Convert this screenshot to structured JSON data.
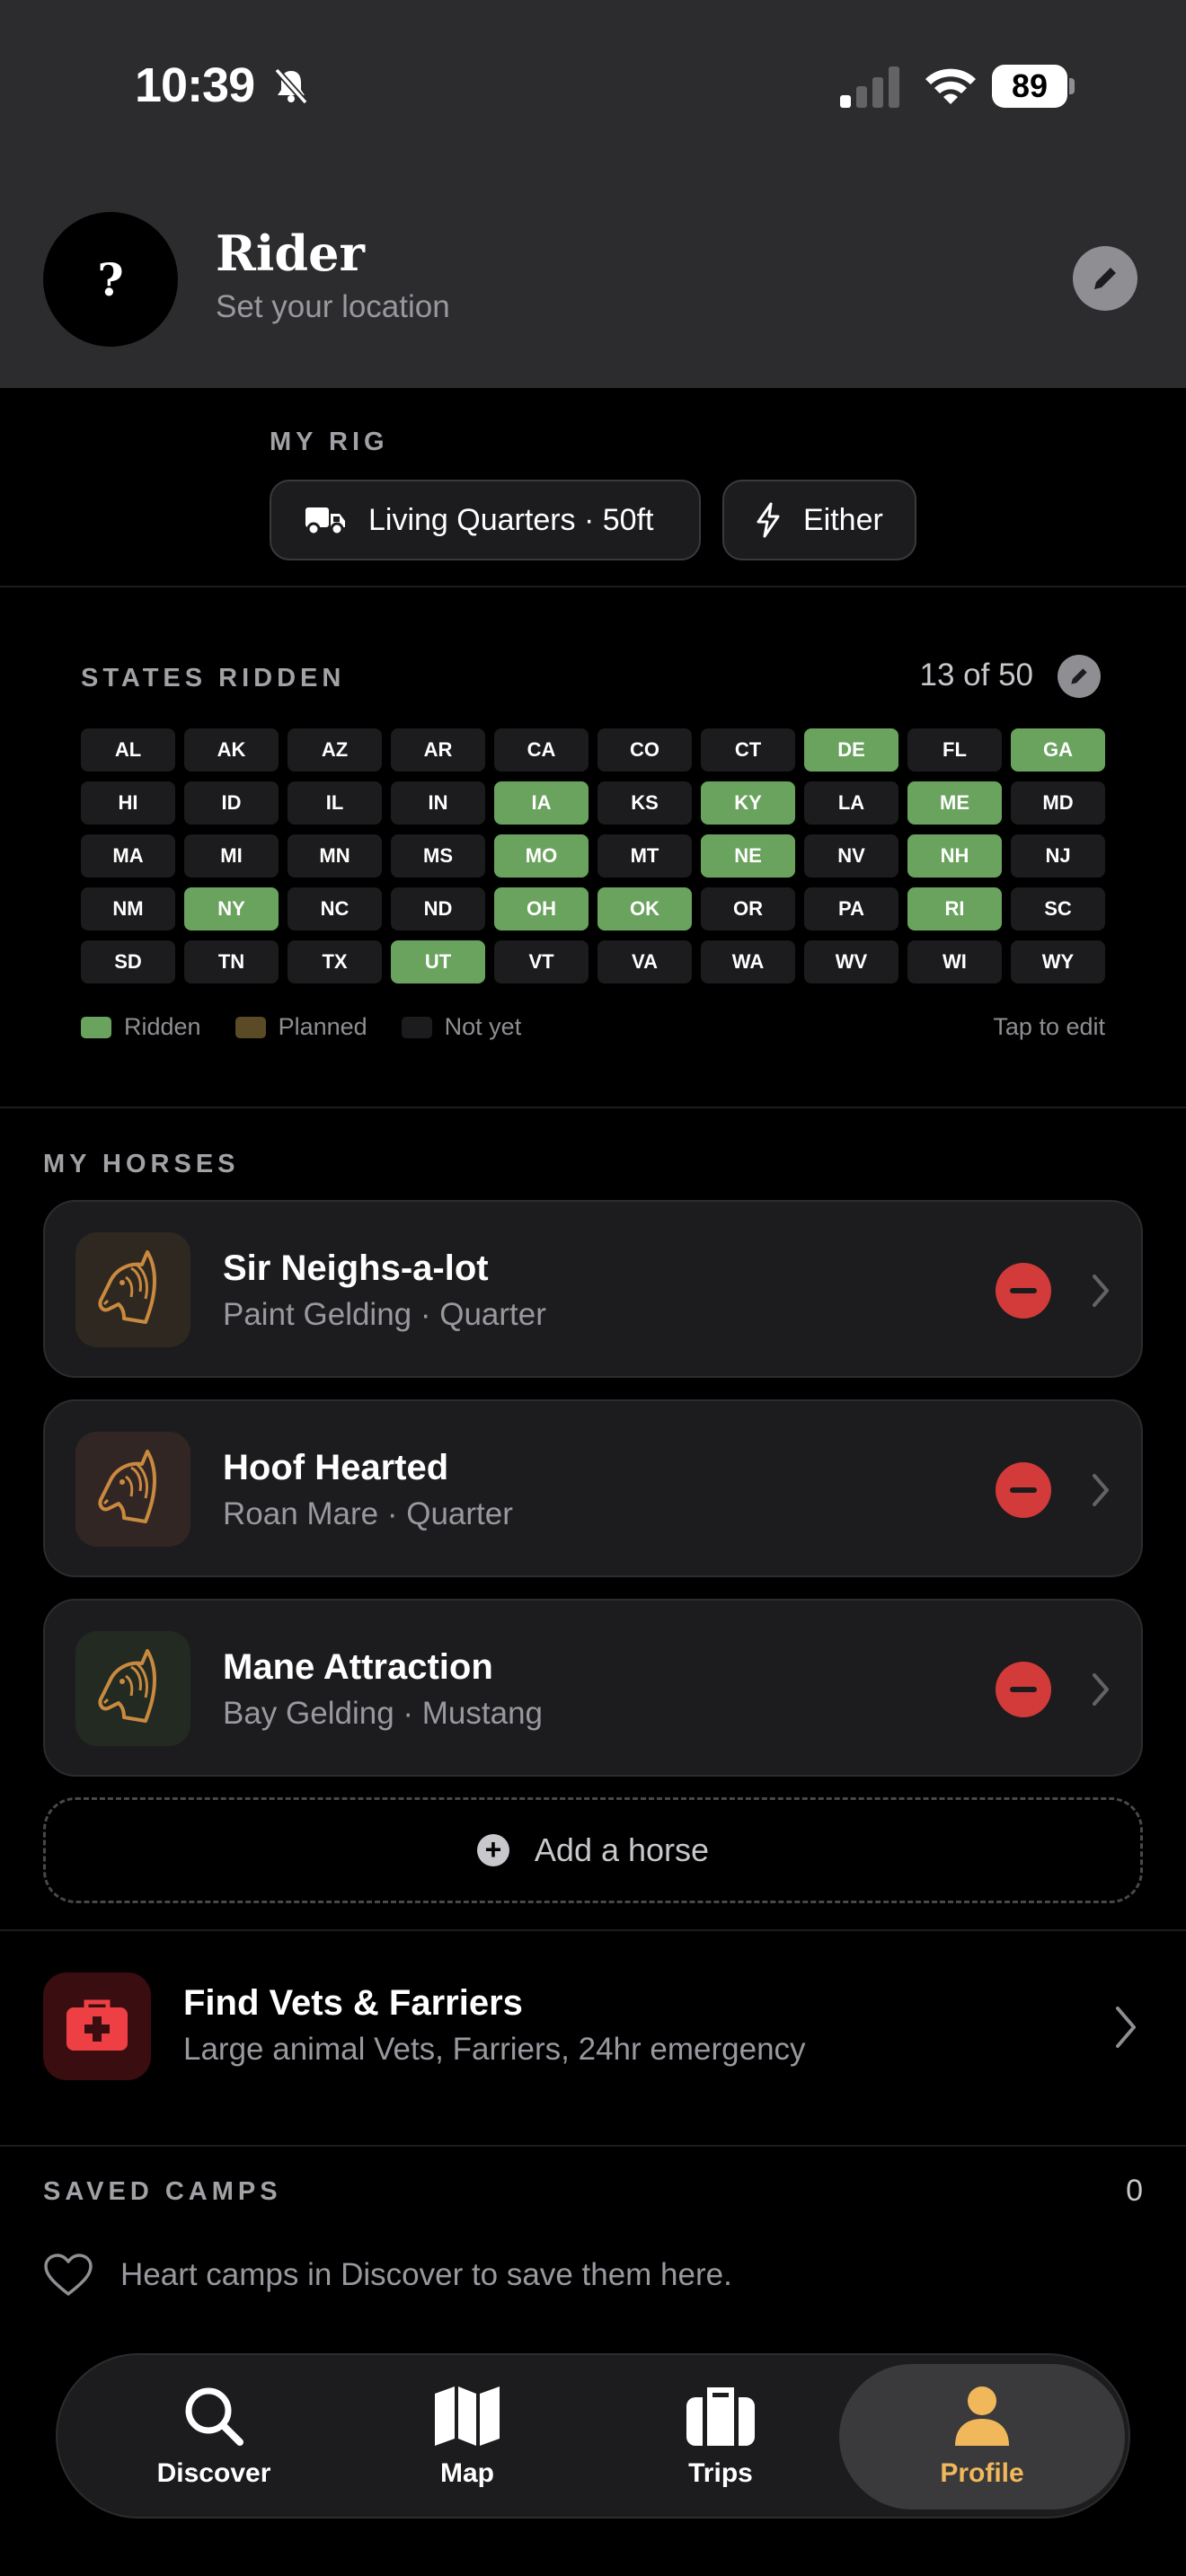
{
  "status_bar": {
    "time": "10:39",
    "battery": "89"
  },
  "profile": {
    "avatar_glyph": "?",
    "name": "Rider",
    "location": "Set your location"
  },
  "rig": {
    "title": "MY RIG",
    "vehicle_label": "Living Quarters · 50ft",
    "hookup_label": "Either"
  },
  "states": {
    "title": "STATES RIDDEN",
    "count": "13 of 50",
    "tap_to_edit": "Tap to edit",
    "legend": {
      "ridden": "Ridden",
      "planned": "Planned",
      "not_yet": "Not yet"
    },
    "colors": {
      "ridden": "#6aa35e",
      "planned": "#5a4a25",
      "not_yet": "#1c1c1e"
    },
    "list": [
      {
        "code": "AL",
        "status": "not_yet"
      },
      {
        "code": "AK",
        "status": "not_yet"
      },
      {
        "code": "AZ",
        "status": "not_yet"
      },
      {
        "code": "AR",
        "status": "not_yet"
      },
      {
        "code": "CA",
        "status": "not_yet"
      },
      {
        "code": "CO",
        "status": "not_yet"
      },
      {
        "code": "CT",
        "status": "not_yet"
      },
      {
        "code": "DE",
        "status": "ridden"
      },
      {
        "code": "FL",
        "status": "not_yet"
      },
      {
        "code": "GA",
        "status": "ridden"
      },
      {
        "code": "HI",
        "status": "not_yet"
      },
      {
        "code": "ID",
        "status": "not_yet"
      },
      {
        "code": "IL",
        "status": "not_yet"
      },
      {
        "code": "IN",
        "status": "not_yet"
      },
      {
        "code": "IA",
        "status": "ridden"
      },
      {
        "code": "KS",
        "status": "not_yet"
      },
      {
        "code": "KY",
        "status": "ridden"
      },
      {
        "code": "LA",
        "status": "not_yet"
      },
      {
        "code": "ME",
        "status": "ridden"
      },
      {
        "code": "MD",
        "status": "not_yet"
      },
      {
        "code": "MA",
        "status": "not_yet"
      },
      {
        "code": "MI",
        "status": "not_yet"
      },
      {
        "code": "MN",
        "status": "not_yet"
      },
      {
        "code": "MS",
        "status": "not_yet"
      },
      {
        "code": "MO",
        "status": "ridden"
      },
      {
        "code": "MT",
        "status": "not_yet"
      },
      {
        "code": "NE",
        "status": "ridden"
      },
      {
        "code": "NV",
        "status": "not_yet"
      },
      {
        "code": "NH",
        "status": "ridden"
      },
      {
        "code": "NJ",
        "status": "not_yet"
      },
      {
        "code": "NM",
        "status": "not_yet"
      },
      {
        "code": "NY",
        "status": "ridden"
      },
      {
        "code": "NC",
        "status": "not_yet"
      },
      {
        "code": "ND",
        "status": "not_yet"
      },
      {
        "code": "OH",
        "status": "ridden"
      },
      {
        "code": "OK",
        "status": "ridden"
      },
      {
        "code": "OR",
        "status": "not_yet"
      },
      {
        "code": "PA",
        "status": "not_yet"
      },
      {
        "code": "RI",
        "status": "ridden"
      },
      {
        "code": "SC",
        "status": "not_yet"
      },
      {
        "code": "SD",
        "status": "not_yet"
      },
      {
        "code": "TN",
        "status": "not_yet"
      },
      {
        "code": "TX",
        "status": "not_yet"
      },
      {
        "code": "UT",
        "status": "ridden"
      },
      {
        "code": "VT",
        "status": "not_yet"
      },
      {
        "code": "VA",
        "status": "not_yet"
      },
      {
        "code": "WA",
        "status": "not_yet"
      },
      {
        "code": "WV",
        "status": "not_yet"
      },
      {
        "code": "WI",
        "status": "not_yet"
      },
      {
        "code": "WY",
        "status": "not_yet"
      }
    ]
  },
  "horses": {
    "title": "MY HORSES",
    "items": [
      {
        "name": "Sir Neighs-a-lot",
        "meta": "Paint Gelding · Quarter",
        "icon": "horse-head-icon",
        "tile_color": "#2e2821"
      },
      {
        "name": "Hoof Hearted",
        "meta": "Roan Mare · Quarter",
        "icon": "horse-head-icon",
        "tile_color": "#322625"
      },
      {
        "name": "Mane Attraction",
        "meta": "Bay Gelding · Mustang",
        "icon": "horse-head-icon",
        "tile_color": "#222a21"
      }
    ],
    "add_label": "Add a horse"
  },
  "vets": {
    "title": "Find Vets & Farriers",
    "subtitle": "Large animal Vets, Farriers, 24hr emergency",
    "icon": "first-aid-kit-icon"
  },
  "saved_camps": {
    "title": "SAVED CAMPS",
    "count": "0",
    "empty_text": "Heart camps in Discover to save them here."
  },
  "tabbar": {
    "discover": "Discover",
    "map": "Map",
    "trips": "Trips",
    "profile": "Profile",
    "active": "profile",
    "active_color": "#f0b85b"
  }
}
